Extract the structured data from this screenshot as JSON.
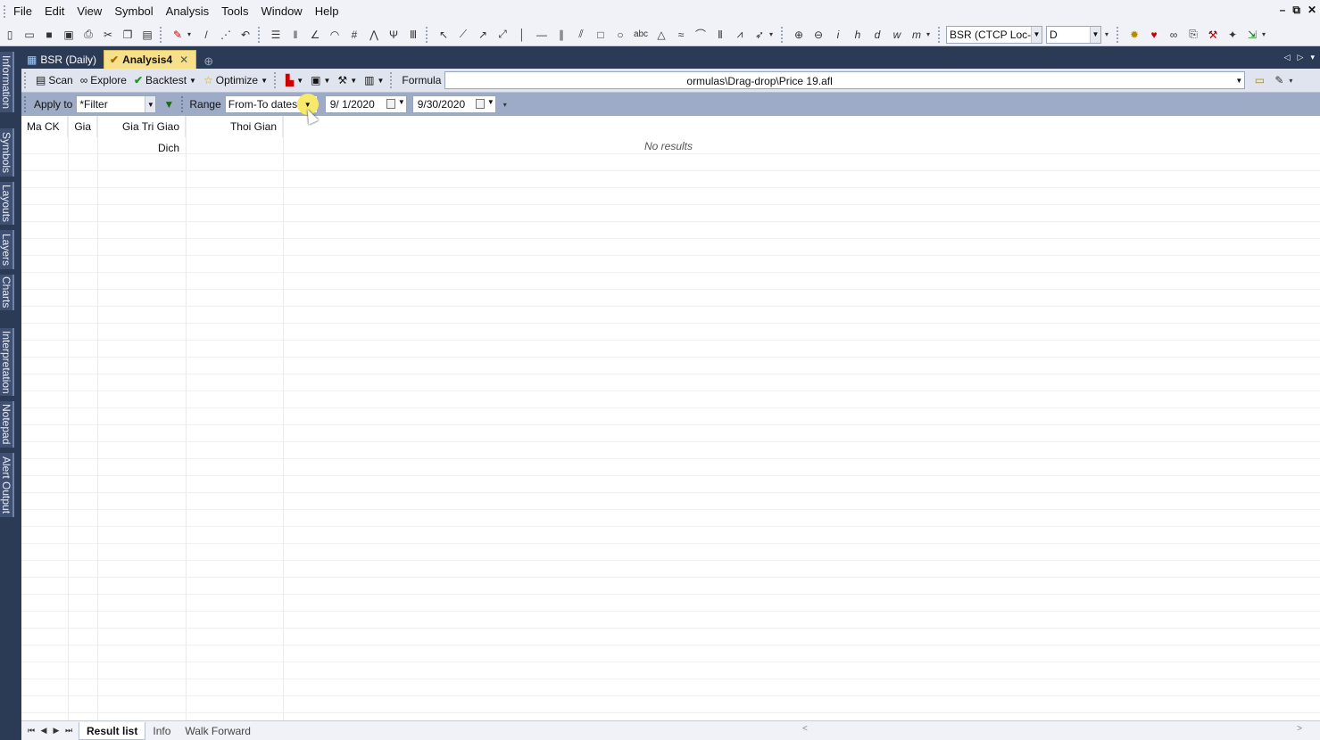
{
  "menu": [
    "File",
    "Edit",
    "View",
    "Symbol",
    "Analysis",
    "Tools",
    "Window",
    "Help"
  ],
  "window_controls": [
    "–",
    "⧉",
    "✕"
  ],
  "toolbar": {
    "symbol_combo": "BSR (CTCP Loc-H",
    "interval_combo": "D",
    "text_tool": "abc",
    "text_icons": [
      "i",
      "h",
      "d",
      "w",
      "m"
    ]
  },
  "left_tabs": [
    "Information",
    "Symbols",
    "Layouts",
    "Layers",
    "Charts",
    "Interpretation",
    "Notepad",
    "Alert Output"
  ],
  "doc_tabs": [
    {
      "label": "BSR (Daily)"
    },
    {
      "label": "Analysis4"
    }
  ],
  "analysis": {
    "scan": "Scan",
    "explore": "Explore",
    "backtest": "Backtest",
    "optimize": "Optimize",
    "formula_label": "Formula",
    "formula_path": "ormulas\\Drag-drop\\Price 19.afl",
    "apply_to_label": "Apply to",
    "apply_to_value": "*Filter",
    "range_label": "Range",
    "range_value": "From-To dates",
    "date_from": "9/ 1/2020",
    "date_to": "9/30/2020"
  },
  "results": {
    "columns": [
      "Ma CK",
      "Gia",
      "Gia Tri Giao Dich",
      "Thoi Gian"
    ],
    "empty_text": "No results"
  },
  "bottom_tabs": [
    "Result list",
    "Info",
    "Walk Forward"
  ],
  "colors": {
    "app_bg": "#2b3a55",
    "active_tab": "#f7e08a",
    "range_bar": "#9eabc6",
    "cursor_highlight": "#f7ea6a"
  }
}
